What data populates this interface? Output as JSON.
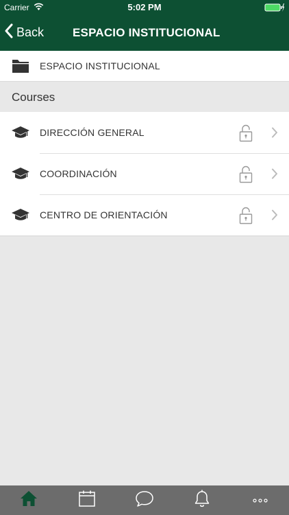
{
  "status_bar": {
    "carrier": "Carrier",
    "time": "5:02 PM",
    "battery_color": "#4cd964"
  },
  "nav": {
    "back_label": "Back",
    "title": "ESPACIO INSTITUCIONAL",
    "background_color": "#0d5033"
  },
  "breadcrumb": {
    "icon": "folder-icon",
    "label": "ESPACIO INSTITUCIONAL"
  },
  "section": {
    "title": "Courses"
  },
  "courses": [
    {
      "label": "DIRECCIÓN GENERAL",
      "icon": "graduation-cap-icon",
      "locked": true
    },
    {
      "label": "COORDINACIÓN",
      "icon": "graduation-cap-icon",
      "locked": true
    },
    {
      "label": "CENTRO DE ORIENTACIÓN",
      "icon": "graduation-cap-icon",
      "locked": true
    }
  ],
  "tab_bar": {
    "background_color": "#6c6c6c",
    "active_color": "#0d5033",
    "items": [
      {
        "icon": "home-icon",
        "active": true
      },
      {
        "icon": "calendar-icon",
        "active": false
      },
      {
        "icon": "chat-icon",
        "active": false
      },
      {
        "icon": "bell-icon",
        "active": false
      },
      {
        "icon": "more-icon",
        "active": false
      }
    ]
  }
}
